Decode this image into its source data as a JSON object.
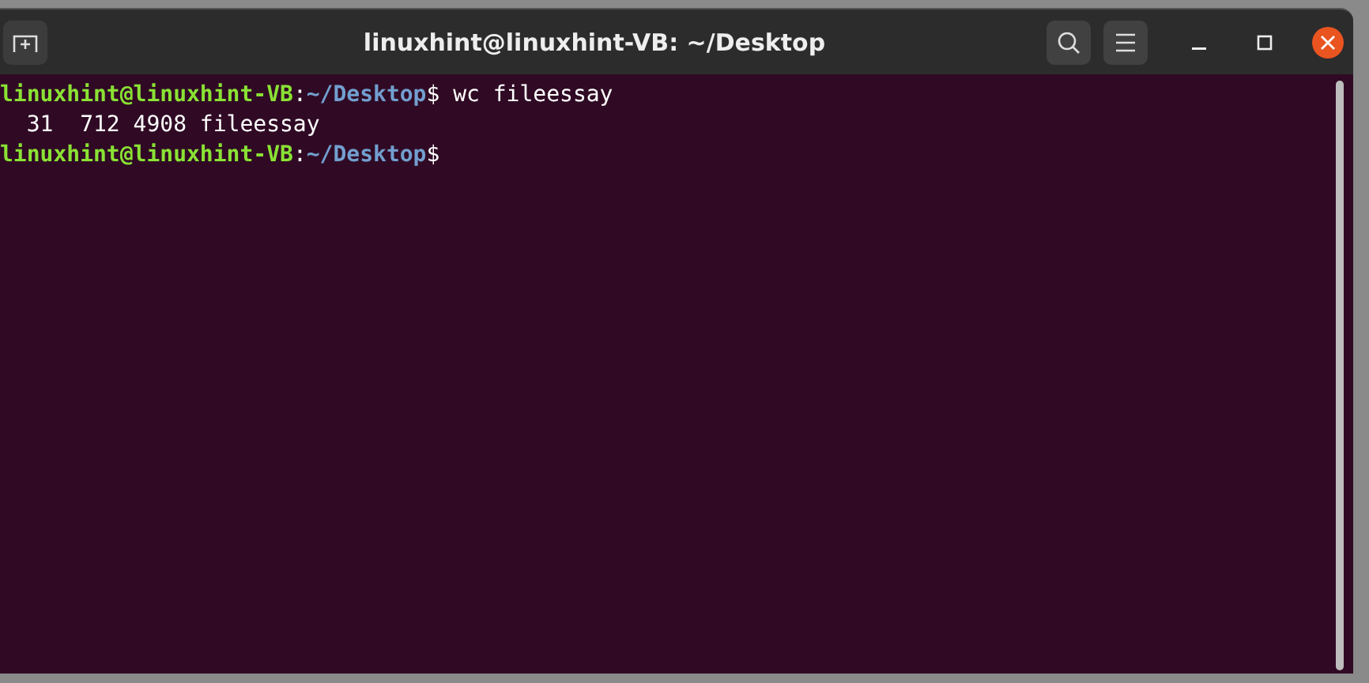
{
  "window": {
    "title": "linuxhint@linuxhint-VB: ~/Desktop"
  },
  "terminal": {
    "lines": [
      [
        {
          "kind": "user",
          "text": "linuxhint@linuxhint-VB"
        },
        {
          "kind": "plain",
          "text": ":"
        },
        {
          "kind": "path",
          "text": "~/Desktop"
        },
        {
          "kind": "plain",
          "text": "$ wc fileessay"
        }
      ],
      [
        {
          "kind": "plain",
          "text": "  31  712 4908 fileessay"
        }
      ],
      [
        {
          "kind": "user",
          "text": "linuxhint@linuxhint-VB"
        },
        {
          "kind": "plain",
          "text": ":"
        },
        {
          "kind": "path",
          "text": "~/Desktop"
        },
        {
          "kind": "plain",
          "text": "$"
        }
      ]
    ]
  }
}
